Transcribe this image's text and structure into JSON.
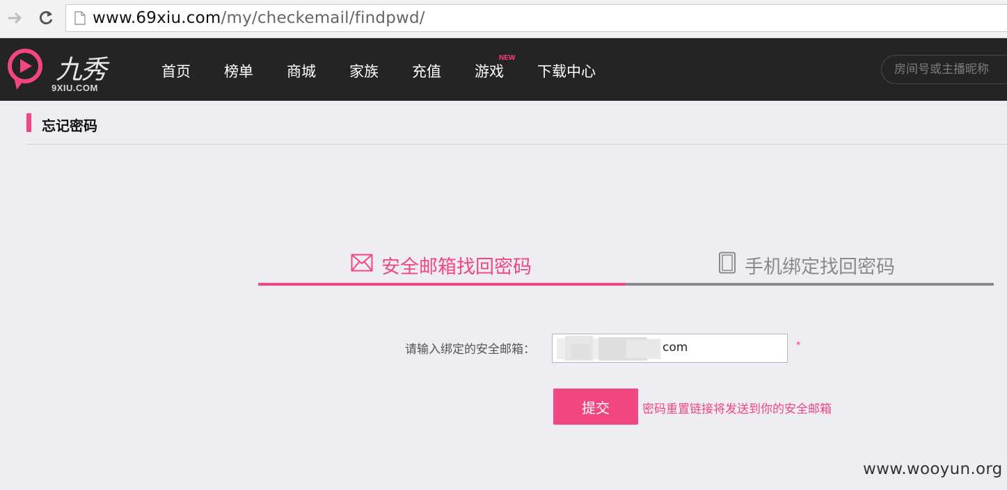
{
  "browser": {
    "url_host": "www.69xiu.com",
    "url_path": "/my/checkemail/findpwd/",
    "back_icon": "arrow-right-icon",
    "reload_icon": "reload-icon"
  },
  "header": {
    "logo_name": "九秀",
    "logo_domain": "9XIU.COM",
    "nav": [
      {
        "label": "首页"
      },
      {
        "label": "榜单"
      },
      {
        "label": "商城"
      },
      {
        "label": "家族"
      },
      {
        "label": "充值"
      },
      {
        "label": "游戏",
        "badge": "NEW"
      },
      {
        "label": "下载中心"
      }
    ],
    "search_placeholder": "房间号或主播昵称"
  },
  "page": {
    "title": "忘记密码"
  },
  "tabs": [
    {
      "label": "安全邮箱找回密码",
      "icon": "envelope-icon",
      "active": true
    },
    {
      "label": "手机绑定找回密码",
      "icon": "phone-icon",
      "active": false
    }
  ],
  "form": {
    "email_label": "请输入绑定的安全邮箱：",
    "email_value_visible": "com",
    "required_mark": "*",
    "submit_label": "提交",
    "hint": "密码重置链接将发送到你的安全邮箱"
  },
  "watermark": "www.wooyun.org",
  "colors": {
    "accent": "#f1467f",
    "header_bg": "#242424",
    "page_bg": "#ededf3"
  }
}
